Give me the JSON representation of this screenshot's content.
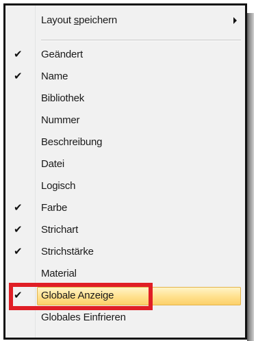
{
  "menu": {
    "submenu_item": {
      "label_pre": "Layout ",
      "label_u": "s",
      "label_post": "peichern"
    },
    "items": [
      {
        "label": "Geändert",
        "checked": true
      },
      {
        "label": "Name",
        "checked": true
      },
      {
        "label": "Bibliothek",
        "checked": false
      },
      {
        "label": "Nummer",
        "checked": false
      },
      {
        "label": "Beschreibung",
        "checked": false
      },
      {
        "label": "Datei",
        "checked": false
      },
      {
        "label": "Logisch",
        "checked": false
      },
      {
        "label": "Farbe",
        "checked": true
      },
      {
        "label": "Strichart",
        "checked": true
      },
      {
        "label": "Strichstärke",
        "checked": true
      },
      {
        "label": "Material",
        "checked": false
      },
      {
        "label": "Globale Anzeige",
        "checked": true,
        "highlighted": true
      },
      {
        "label": "Globales Einfrieren",
        "checked": false
      }
    ],
    "check_glyph": "✔",
    "accent_highlight": "#ffe08c",
    "annotation_color": "#e01e26"
  }
}
